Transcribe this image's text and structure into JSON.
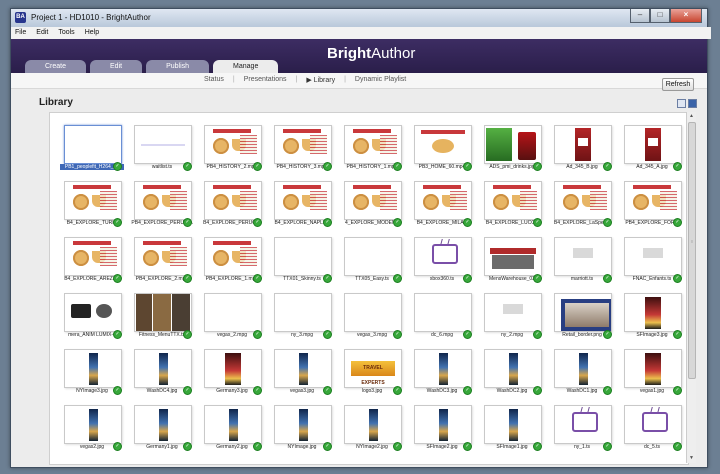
{
  "window": {
    "title": "Project 1 - HD1010 - BrightAuthor",
    "app_icon": "BA"
  },
  "menu": [
    "File",
    "Edit",
    "Tools",
    "Help"
  ],
  "brand": {
    "bold": "Bright",
    "rest": "Author"
  },
  "tabs": [
    "Create",
    "Edit",
    "Publish",
    "Manage"
  ],
  "subnav": {
    "status": "Status",
    "presentations": "Presentations",
    "library": "Library",
    "playlist": "Dynamic Playlist",
    "library_marker": "▶"
  },
  "actions": {
    "refresh": "Refresh"
  },
  "library": {
    "title": "Library"
  },
  "colors": {
    "header": "#2f2252",
    "selection": "#3f68b6",
    "check": "#38a83b"
  },
  "items": [
    {
      "name": "PB1_peoplefit_H264_10",
      "type": "night",
      "selected": true
    },
    {
      "name": "waitlist.ts",
      "type": "purple"
    },
    {
      "name": "PB4_HISTORY_2.mp4",
      "type": "pizza"
    },
    {
      "name": "PB4_HISTORY_3.mp4",
      "type": "pizza"
    },
    {
      "name": "PB4_HISTORY_1.mp4",
      "type": "pizza"
    },
    {
      "name": "PB3_HOME_60.mp4",
      "type": "homepizza"
    },
    {
      "name": "ADS_pmi_drinks.jpg",
      "type": "drinks"
    },
    {
      "name": "Ad_345_B.jpg",
      "type": "price"
    },
    {
      "name": "Ad_345_A.jpg",
      "type": "price"
    },
    {
      "name": "B4_EXPLORE_TURIN",
      "type": "pizza"
    },
    {
      "name": "PB4_EXPLORE_PERUGIA",
      "type": "pizza"
    },
    {
      "name": "B4_EXPLORE_PERUGIA",
      "type": "pizza"
    },
    {
      "name": "B4_EXPLORE_NAPLES",
      "type": "pizza"
    },
    {
      "name": "4_EXPLORE_MODENA",
      "type": "pizza"
    },
    {
      "name": "B4_EXPLORE_MILAN",
      "type": "pizza"
    },
    {
      "name": "B4_EXPLORE_LUCCA",
      "type": "pizza"
    },
    {
      "name": "B4_EXPLORE_LaSpezia",
      "type": "pizza"
    },
    {
      "name": "PB4_EXPLORE_FORLI",
      "type": "pizza"
    },
    {
      "name": "B4_EXPLORE_AREZZO",
      "type": "pizza"
    },
    {
      "name": "PB4_EXPLORE_2.mp4",
      "type": "pizza"
    },
    {
      "name": "PB4_EXPLORE_1.mp4",
      "type": "pizza"
    },
    {
      "name": "TTX01_Skinny.ts",
      "type": "black"
    },
    {
      "name": "TTX05_Easy.ts",
      "type": "black"
    },
    {
      "name": "xbox360.ts",
      "type": "tv"
    },
    {
      "name": "MensWarehouse_03",
      "type": "mall"
    },
    {
      "name": "marriott.ts",
      "type": "white"
    },
    {
      "name": "FNAC_Enfants.ts",
      "type": "white"
    },
    {
      "name": "mera_ANIM LUMIX-1",
      "type": "camera"
    },
    {
      "name": "Fitness_MenuTTX.ts",
      "type": "fitness"
    },
    {
      "name": "vegas_2.mpg",
      "type": "night"
    },
    {
      "name": "ny_3.mpg",
      "type": "night"
    },
    {
      "name": "vegas_3.mpg",
      "type": "night"
    },
    {
      "name": "dc_6.mpg",
      "type": "night"
    },
    {
      "name": "ny_2.mpg",
      "type": "white"
    },
    {
      "name": "Retail_border.png",
      "type": "retail"
    },
    {
      "name": "SFImage3.jpg",
      "type": "tallred"
    },
    {
      "name": "NYImage3.jpg",
      "type": "tall"
    },
    {
      "name": "WashDC4.jpg",
      "type": "tall"
    },
    {
      "name": "Germany3.jpg",
      "type": "tallred"
    },
    {
      "name": "vegas3.jpg",
      "type": "tall"
    },
    {
      "name": "logo3.jpg",
      "type": "travel",
      "label": "TRAVEL EXPERTS"
    },
    {
      "name": "WashDC3.jpg",
      "type": "tall"
    },
    {
      "name": "WashDC2.jpg",
      "type": "tall"
    },
    {
      "name": "WashDC1.jpg",
      "type": "tall"
    },
    {
      "name": "vegas1.jpg",
      "type": "tallred"
    },
    {
      "name": "vegas2.jpg",
      "type": "tall"
    },
    {
      "name": "Germany1.jpg",
      "type": "tall"
    },
    {
      "name": "Germany2.jpg",
      "type": "tall"
    },
    {
      "name": "NYImage.jpg",
      "type": "tall"
    },
    {
      "name": "NYImage2.jpg",
      "type": "tall"
    },
    {
      "name": "SFImage2.jpg",
      "type": "tall"
    },
    {
      "name": "SFImage1.jpg",
      "type": "tall"
    },
    {
      "name": "ny_1.ts",
      "type": "tv"
    },
    {
      "name": "dc_5.ts",
      "type": "tv"
    }
  ]
}
